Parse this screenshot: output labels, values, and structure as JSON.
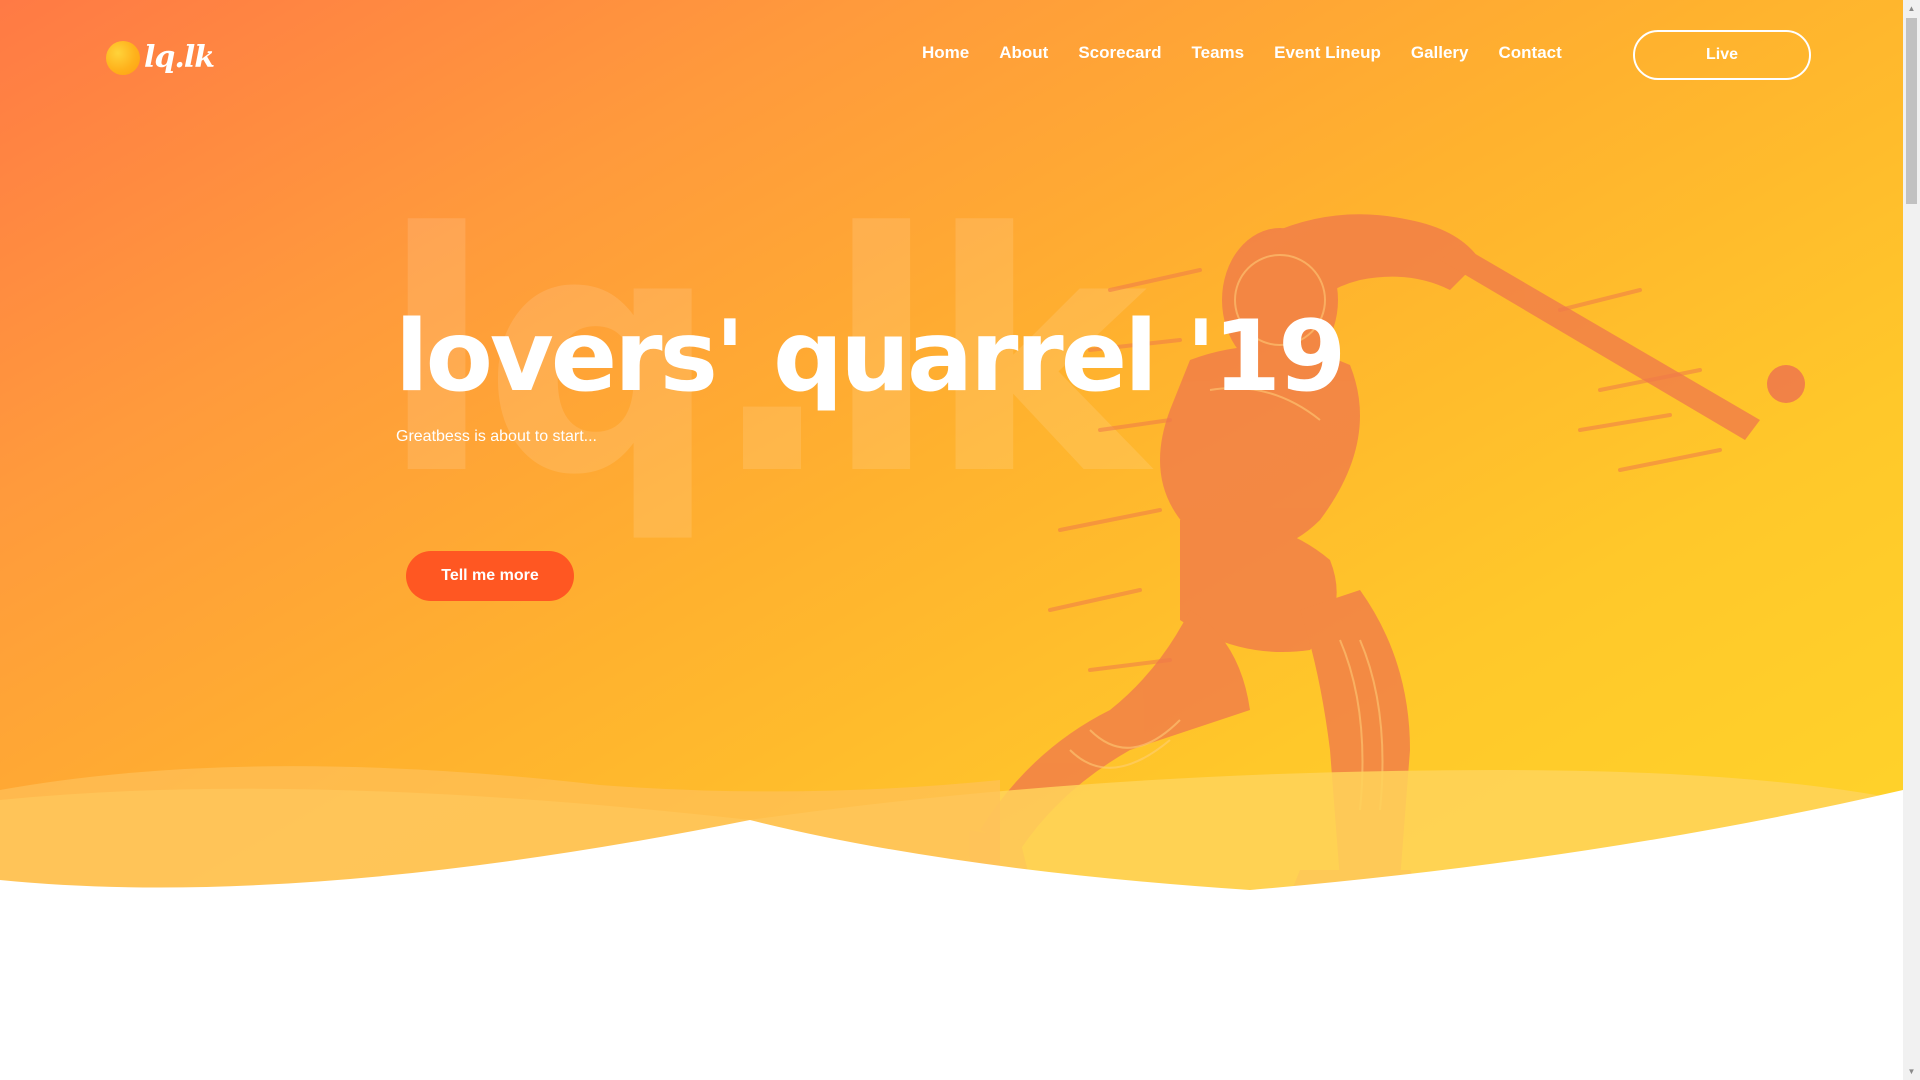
{
  "brand": {
    "name": "lq.lk",
    "watermark": "lq.lk"
  },
  "nav": {
    "items": [
      "Home",
      "About",
      "Scorecard",
      "Teams",
      "Event Lineup",
      "Gallery",
      "Contact"
    ],
    "live_label": "Live"
  },
  "hero": {
    "title": "lovers' quarrel '19",
    "subtitle": "Greatbess is about to start...",
    "cta_label": "Tell me more"
  },
  "colors": {
    "gradient_start": "#ff7a45",
    "gradient_end": "#ffd42a",
    "cta": "#ff5722",
    "figure": "#f07a4a"
  },
  "icons": {
    "scroll_up": "triangle-up",
    "scroll_down": "triangle-down"
  }
}
